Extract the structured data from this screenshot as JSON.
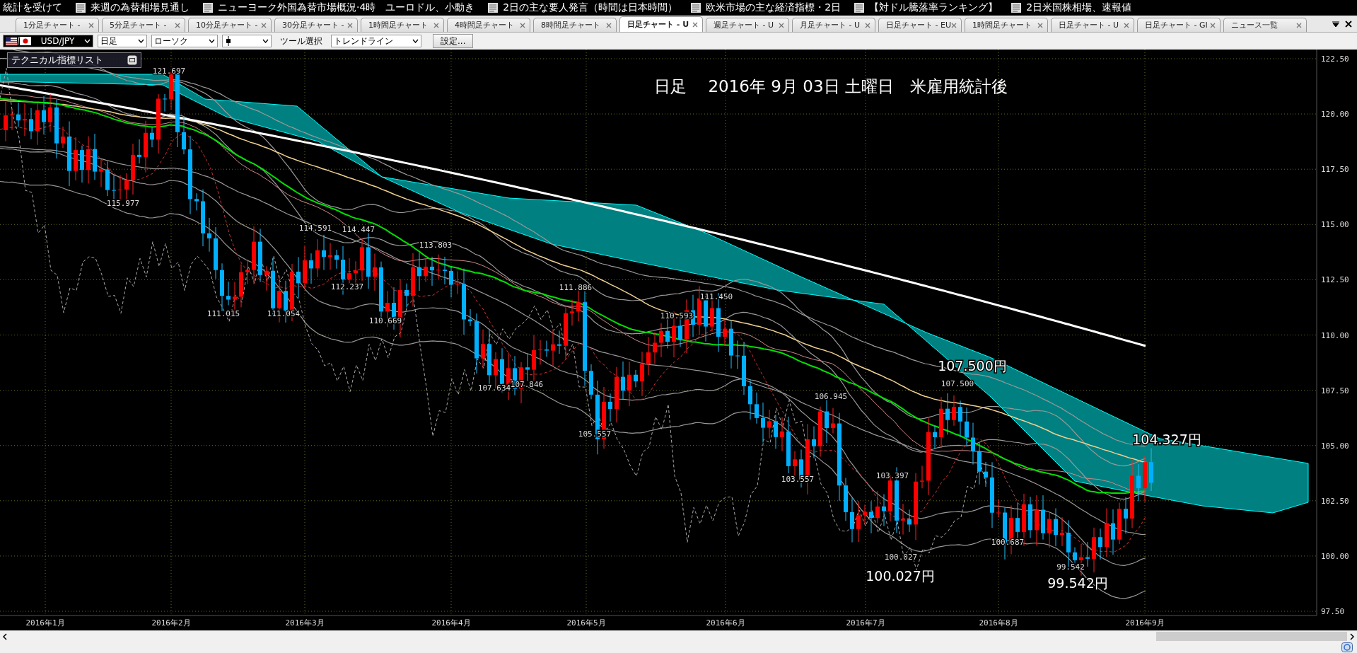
{
  "ticker": [
    "統計を受けて",
    "来週の為替相場見通し",
    "ニューヨーク外国為替市場概況·4時　ユーロドル、小動き",
    "2日の主な要人発言（時間は日本時間）",
    "欧米市場の主な経済指標・2日",
    "【対ドル騰落率ランキング】",
    "2日米国株相場、速報値"
  ],
  "tabs": [
    {
      "label": "1分足チャート -",
      "selected": false
    },
    {
      "label": "5分足チャート -",
      "selected": false
    },
    {
      "label": "10分足チャート -",
      "selected": false
    },
    {
      "label": "30分足チャート -",
      "selected": false
    },
    {
      "label": "1時間足チャート",
      "selected": false
    },
    {
      "label": "4時間足チャート",
      "selected": false
    },
    {
      "label": "8時間足チャート",
      "selected": false
    },
    {
      "label": "日足チャート - U",
      "selected": true
    },
    {
      "label": "週足チャート - U",
      "selected": false
    },
    {
      "label": "月足チャート - U",
      "selected": false
    },
    {
      "label": "日足チャート - EU",
      "selected": false
    },
    {
      "label": "1時間足チャート",
      "selected": false
    },
    {
      "label": "日足チャート - U",
      "selected": false
    },
    {
      "label": "日足チャート - GI",
      "selected": false
    },
    {
      "label": "ニュース一覧",
      "selected": false
    }
  ],
  "toolbar": {
    "symbol": "USD/JPY",
    "timeframe": "日足",
    "chart_type": "ローソク",
    "tool_label": "ツール選択",
    "tool": "トレンドライン",
    "settings_button": "設定..."
  },
  "chart": {
    "title": "日足　 2016年 9月 03日 土曜日　米雇用統計後",
    "indicator_panel": "テクニカル指標リスト",
    "y_axis_labels": [
      "122.50",
      "120.00",
      "117.50",
      "115.00",
      "112.50",
      "110.00",
      "107.50",
      "105.00",
      "102.50",
      "100.00",
      "97.50"
    ],
    "x_axis_labels": [
      "2016年1月",
      "2016年2月",
      "2016年3月",
      "2016年4月",
      "2016年5月",
      "2016年6月",
      "2016年7月",
      "2016年8月",
      "2016年9月"
    ],
    "price_marks": [
      "121.697",
      "115.977",
      "114.591",
      "114.447",
      "111.015",
      "111.054",
      "112.237",
      "113.803",
      "110.669",
      "107.634",
      "107.846",
      "111.886",
      "105.557",
      "110.593",
      "111.450",
      "106.945",
      "103.557",
      "103.397",
      "100.027",
      "107.500",
      "100.687",
      "99.542"
    ],
    "callouts": [
      "107.500円",
      "104.327円",
      "100.027円",
      "99.542円"
    ]
  }
}
